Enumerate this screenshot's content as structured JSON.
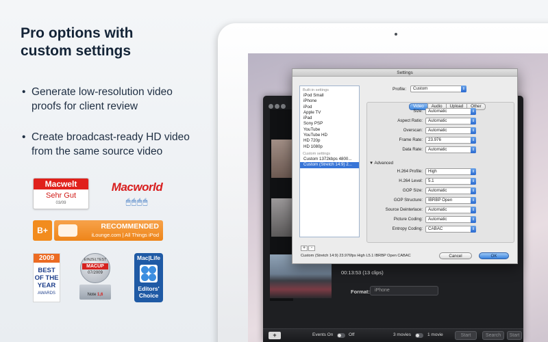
{
  "marketing": {
    "headline_line1": "Pro options with",
    "headline_line2": "custom settings",
    "bullets": [
      {
        "dot": "•",
        "line1": "Generate low-resolution video",
        "line2": "proofs for client review"
      },
      {
        "dot": "•",
        "line1": "Create broadcast-ready HD video",
        "line2": "from the same source video"
      }
    ]
  },
  "badges": {
    "macwelt": {
      "name": "Macwelt",
      "rating": "Sehr Gut",
      "issue": "03/09"
    },
    "macworld": {
      "name": "Macworld",
      "mice": "🖱🖱🖱🖱"
    },
    "ilounge": {
      "grade": "B+",
      "label": "RECOMMENDED",
      "site": "iLounge.com | All Things iPod"
    },
    "best_of_year": {
      "year": "2009",
      "line1": "BEST",
      "line2": "OF THE",
      "line3": "YEAR",
      "line4": "AWARDS"
    },
    "macup": {
      "top": "EINZELTEST",
      "brand": "MACUP",
      "issue": "07/2009",
      "grade_label": "Note",
      "grade": "1,6"
    },
    "maclife": {
      "line1": "Mac|Life",
      "line2": "Editors'",
      "line3": "Choice"
    }
  },
  "dialog": {
    "title": "Settings",
    "builtin_header": "Built-in settings",
    "builtin_items": [
      "iPod Small",
      "iPhone",
      "iPod",
      "Apple TV",
      "iPad",
      "Sony PSP",
      "YouTube",
      "YouTube HD",
      "HD 720p",
      "HD 1080p"
    ],
    "custom_header": "Custom settings",
    "custom_items": [
      "Custom 1372kbps 4800...",
      "Custom (Stretch 14:9) 2..."
    ],
    "profile_label": "Profile:",
    "profile_value": "Custom",
    "tabs": [
      "Video",
      "Audio",
      "Upload",
      "Other"
    ],
    "rows": [
      {
        "label": "Size:",
        "value": "Automatic"
      },
      {
        "label": "Aspect Ratio:",
        "value": "Automatic"
      },
      {
        "label": "Overscan:",
        "value": "Automatic"
      },
      {
        "label": "Frame Rate:",
        "value": "23.976"
      },
      {
        "label": "Data Rate:",
        "value": "Automatic"
      }
    ],
    "advanced_label": "▼ Advanced",
    "advanced_rows": [
      {
        "label": "H.264 Profile:",
        "value": "High"
      },
      {
        "label": "H.264 Level:",
        "value": "5.1"
      },
      {
        "label": "GOP Size:",
        "value": "Automatic"
      },
      {
        "label": "GOP Structure:",
        "value": "IBRBP Open"
      },
      {
        "label": "Source Deinterlace:",
        "value": "Automatic"
      },
      {
        "label": "Picture Coding:",
        "value": "Automatic"
      },
      {
        "label": "Entropy Coding:",
        "value": "CABAC"
      }
    ],
    "add": "+",
    "remove": "-",
    "summary": "Custom (Stretch 14:9) 23.976fps High L5.1 IBRBP Open CABAC",
    "cancel": "Cancel",
    "ok": "OK"
  },
  "app": {
    "clip_time": "00:13:53 (13 clips)",
    "format_label": "Format:",
    "format_value": "iPhone",
    "add_button": "+",
    "events_on": "Events On",
    "off": "Off",
    "movies": "3 movies",
    "one_movie": "1 movie",
    "start": "Start",
    "search": "Search",
    "start2": "Start"
  }
}
